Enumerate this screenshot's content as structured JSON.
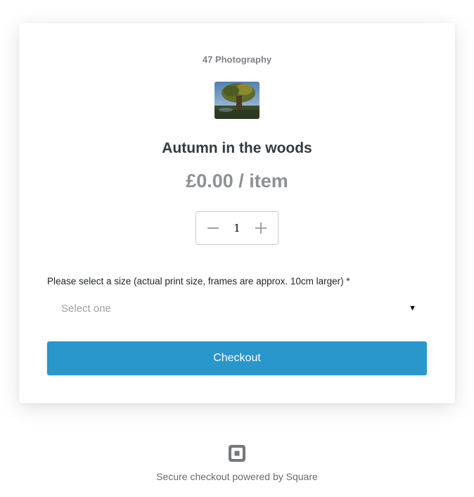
{
  "merchant": {
    "name": "47 Photography"
  },
  "product": {
    "title": "Autumn in the woods",
    "price": "£0.00 / item",
    "image_icon": "product-photo-tree"
  },
  "quantity": {
    "value": "1",
    "decrement_icon": "minus-icon",
    "increment_icon": "plus-icon"
  },
  "size_select": {
    "label": "Please select a size (actual print size, frames are approx. 10cm larger) *",
    "placeholder": "Select one",
    "arrow": "▼"
  },
  "checkout_button": {
    "label": "Checkout",
    "color": "#2996cc"
  },
  "footer": {
    "text": "Secure checkout powered by Square",
    "logo_icon": "square-logo-icon"
  }
}
